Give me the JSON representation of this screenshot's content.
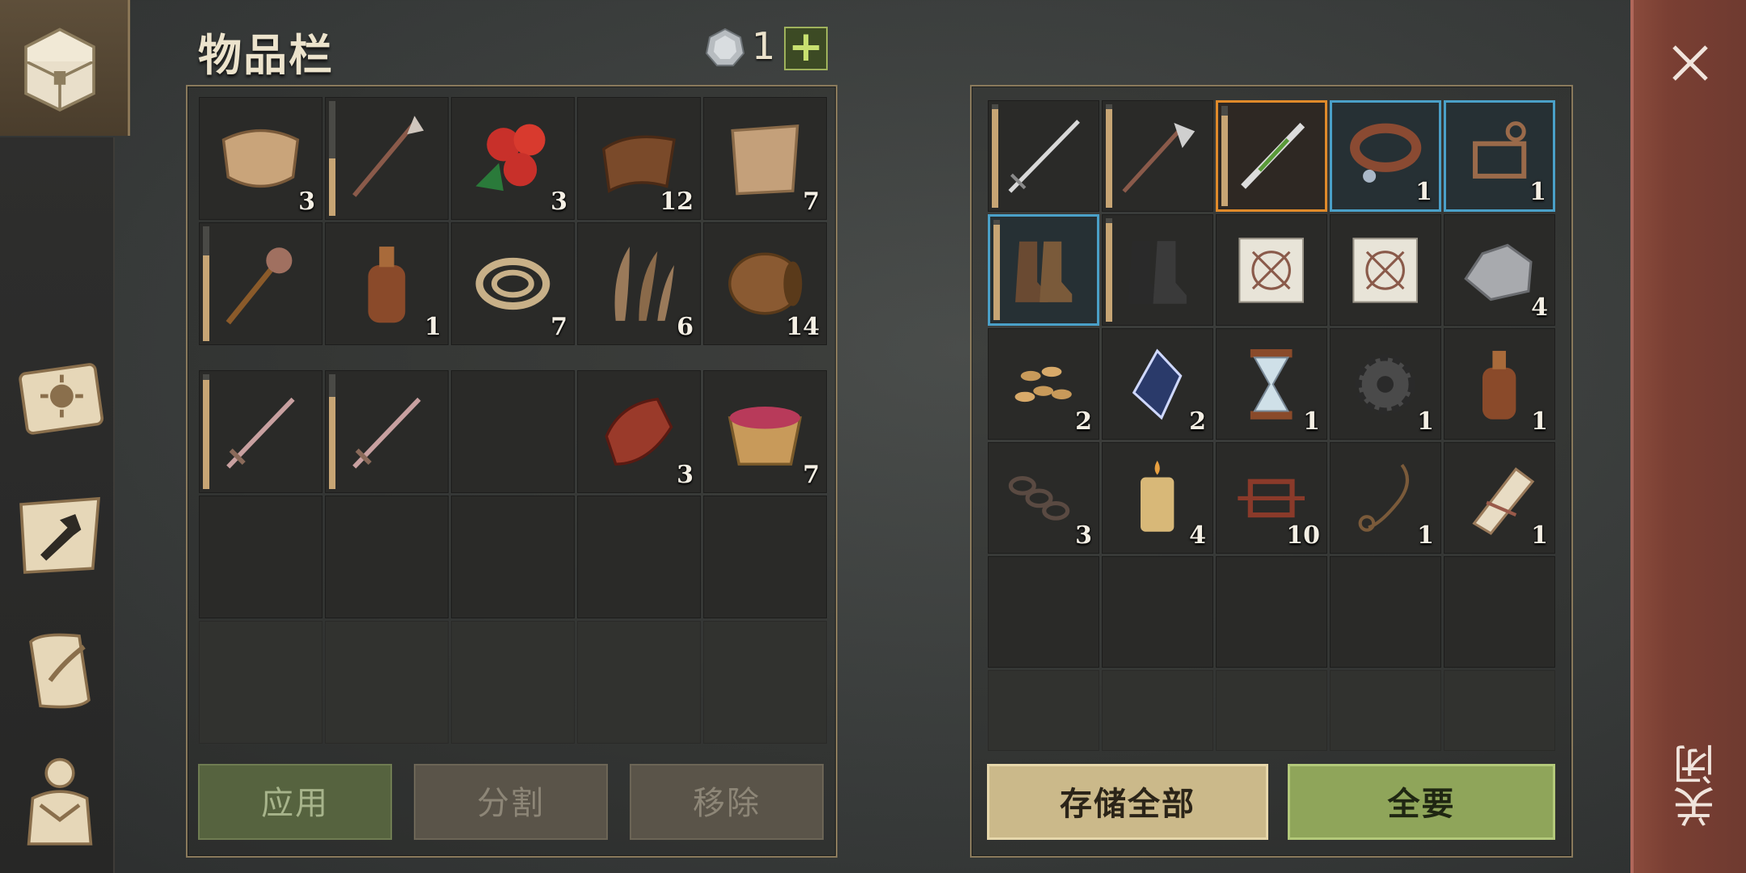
{
  "inventory": {
    "title": "物品栏",
    "currency": {
      "icon": "silver-coin-icon",
      "count": "1"
    },
    "add_label": "+",
    "top_rows": [
      [
        {
          "icon": "cloth-bundle-icon",
          "count": "3"
        },
        {
          "icon": "spear-icon",
          "count": "",
          "durability": 0.5
        },
        {
          "icon": "berries-icon",
          "count": "3"
        },
        {
          "icon": "leather-icon",
          "count": "12"
        },
        {
          "icon": "fiber-cloth-icon",
          "count": "7"
        }
      ],
      [
        {
          "icon": "mace-icon",
          "count": "",
          "durability": 0.75
        },
        {
          "icon": "bottle-icon",
          "count": "1"
        },
        {
          "icon": "rope-icon",
          "count": "7"
        },
        {
          "icon": "plant-fiber-icon",
          "count": "6"
        },
        {
          "icon": "barrel-icon",
          "count": "14"
        }
      ]
    ],
    "bottom_rows": [
      [
        {
          "icon": "sword-icon",
          "count": "",
          "durability": 0.95
        },
        {
          "icon": "sword-icon",
          "count": "",
          "durability": 0.8
        },
        {
          "icon": "",
          "count": ""
        },
        {
          "icon": "raw-meat-icon",
          "count": "3"
        },
        {
          "icon": "berry-bowl-icon",
          "count": "7"
        }
      ]
    ],
    "buttons": {
      "apply": "应用",
      "split": "分割",
      "remove": "移除"
    }
  },
  "storage": {
    "rows": [
      [
        {
          "icon": "longsword-icon",
          "count": "",
          "durability": 0.95,
          "style": ""
        },
        {
          "icon": "halberd-icon",
          "count": "",
          "durability": 0.95,
          "style": ""
        },
        {
          "icon": "poison-blade-icon",
          "count": "",
          "durability": 0.9,
          "style": "orange"
        },
        {
          "icon": "collar-icon",
          "count": "1",
          "style": "blue"
        },
        {
          "icon": "bridle-icon",
          "count": "1",
          "style": "blue"
        }
      ],
      [
        {
          "icon": "leather-boots-icon",
          "count": "",
          "durability": 0.95,
          "style": "blue"
        },
        {
          "icon": "dark-boots-icon",
          "count": "",
          "durability": 0.95,
          "style": ""
        },
        {
          "icon": "blueprint-icon",
          "count": "",
          "style": ""
        },
        {
          "icon": "blueprint-icon",
          "count": "",
          "style": ""
        },
        {
          "icon": "iron-ore-icon",
          "count": "4",
          "style": ""
        }
      ],
      [
        {
          "icon": "seeds-icon",
          "count": "2",
          "style": ""
        },
        {
          "icon": "crystal-icon",
          "count": "2",
          "style": ""
        },
        {
          "icon": "hourglass-icon",
          "count": "1",
          "style": ""
        },
        {
          "icon": "gear-icon",
          "count": "1",
          "style": ""
        },
        {
          "icon": "bottle-icon",
          "count": "1",
          "style": ""
        }
      ],
      [
        {
          "icon": "chain-icon",
          "count": "3",
          "style": ""
        },
        {
          "icon": "candle-icon",
          "count": "4",
          "style": ""
        },
        {
          "icon": "scrap-icon",
          "count": "10",
          "style": ""
        },
        {
          "icon": "noose-icon",
          "count": "1",
          "style": ""
        },
        {
          "icon": "scroll-icon",
          "count": "1",
          "style": ""
        }
      ]
    ],
    "buttons": {
      "store_all": "存储全部",
      "take_all": "全要"
    }
  },
  "close": {
    "label": "关闭"
  },
  "tabs": [
    "chest-icon",
    "map-book-icon",
    "crafting-icon",
    "quest-scroll-icon",
    "character-icon"
  ]
}
